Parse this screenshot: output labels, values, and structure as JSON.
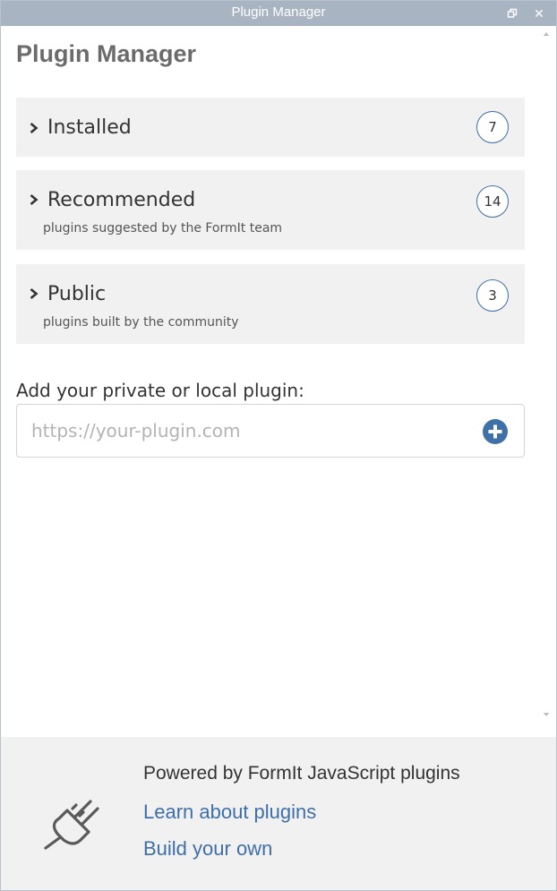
{
  "window": {
    "title": "Plugin Manager",
    "restore_icon": "restore-window-icon",
    "close_icon": "close-icon"
  },
  "page": {
    "title": "Plugin Manager"
  },
  "categories": [
    {
      "label": "Installed",
      "subtitle": "",
      "count": "7",
      "icon": "chevron-right-icon"
    },
    {
      "label": "Recommended",
      "subtitle": "plugins suggested by the FormIt team",
      "count": "14",
      "icon": "chevron-right-icon"
    },
    {
      "label": "Public",
      "subtitle": "plugins built by the community",
      "count": "3",
      "icon": "chevron-right-icon"
    }
  ],
  "add_plugin": {
    "label": "Add your private or local plugin:",
    "placeholder": "https://your-plugin.com",
    "value": "",
    "button_icon": "plus-circle-icon"
  },
  "footer": {
    "icon": "plug-icon",
    "powered_by": "Powered by FormIt JavaScript plugins",
    "learn_link": "Learn about plugins",
    "build_link": "Build your own"
  },
  "colors": {
    "titlebar": "#a9b4c2",
    "accent": "#3f70a8",
    "panel": "#f1f1f1",
    "link": "#3f6fa8"
  }
}
